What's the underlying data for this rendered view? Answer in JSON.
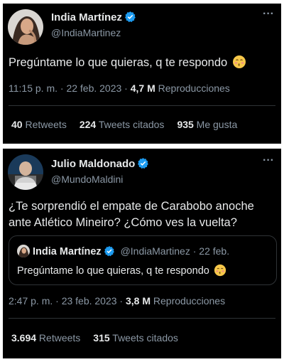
{
  "tweet1": {
    "author_name": "India Martínez",
    "author_handle": "@IndiaMartinez",
    "text": "Pregúntame lo que quieras, q te respondo",
    "emoji": "kissing-face-icon",
    "time_date": "11:15 p. m. · 22 feb. 2023 · ",
    "views_count": "4,7 M",
    "views_label": " Reproducciones",
    "retweets_count": "40",
    "retweets_label": " Retweets",
    "quotes_count": "224",
    "quotes_label": " Tweets citados",
    "likes_count": "935",
    "likes_label": " Me gusta"
  },
  "tweet2": {
    "author_name": "Julio Maldonado",
    "author_handle": "@MundoMaldini",
    "text_line1": "¿Te sorprendió el empate de Carabobo anoche",
    "text_line2": "ante Atlético Mineiro? ¿Cómo ves la vuelta?",
    "quoted": {
      "author_name": "India Martínez",
      "author_handle": "@IndiaMartinez",
      "date": " · 22 feb.",
      "text": "Pregúntame lo que quieras, q te respondo"
    },
    "time_date": "2:47 p. m. · 23 feb. 2023 · ",
    "views_count": "3,8 M",
    "views_label": " Reproducciones",
    "retweets_count": "3.694",
    "retweets_label": " Retweets",
    "quotes_count": "315",
    "quotes_label": " Tweets citados"
  },
  "colors": {
    "background": "#000000",
    "text": "#e7e9ea",
    "secondary_text": "#8b98a5",
    "verified_badge": "#1d9bf0",
    "divider": "#2f3336"
  }
}
